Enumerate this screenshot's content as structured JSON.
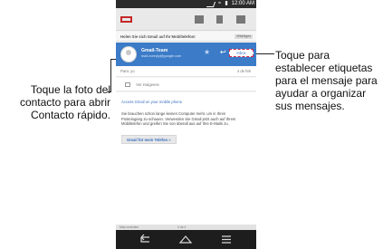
{
  "callouts": {
    "left": "Toque la foto del contacto para abrir Contacto rápido.",
    "right": "Toque para establecer etiquetas para el mensaje para ayudar a organizar sus mensajes."
  },
  "status_bar": {
    "time": "12:00 AM"
  },
  "email": {
    "subject": "Holen Sie sich Gmail auf Ihr Mobiltelefon!",
    "label": "Wichtiges",
    "sender_name": "Gmail-Team",
    "sender_address": "mail-noreply@google.com",
    "inbox_label": "Inbox",
    "to": "Para: yo",
    "date": "4 de feb",
    "show_images": "Ver imágenes",
    "link_text": "Access Gmail on your mobile phone",
    "body": "Sie brauchen schon lange keinen Computer mehr, um in Ihren Posteingang zu schauen. Verwenden Sie Gmail jetzt auch auf Ihrem Mobiltelefon und greifen Sie von überall aus auf Ihre E-Mails zu.",
    "button": "Gmail für mein Telefon »"
  },
  "pager": {
    "left": "Más recientes",
    "indicator": "4 de 4"
  },
  "colors": {
    "sender_bar": "#3b7bc8",
    "label_border": "#cc2b4a",
    "nav_bar": "#1d1d1d"
  },
  "icons": [
    "signal-icon",
    "wifi-icon",
    "battery-icon",
    "gmail-logo-icon",
    "archive-icon",
    "delete-icon",
    "mail-icon",
    "star-icon",
    "reply-icon",
    "back-icon",
    "home-icon",
    "menu-icon"
  ]
}
